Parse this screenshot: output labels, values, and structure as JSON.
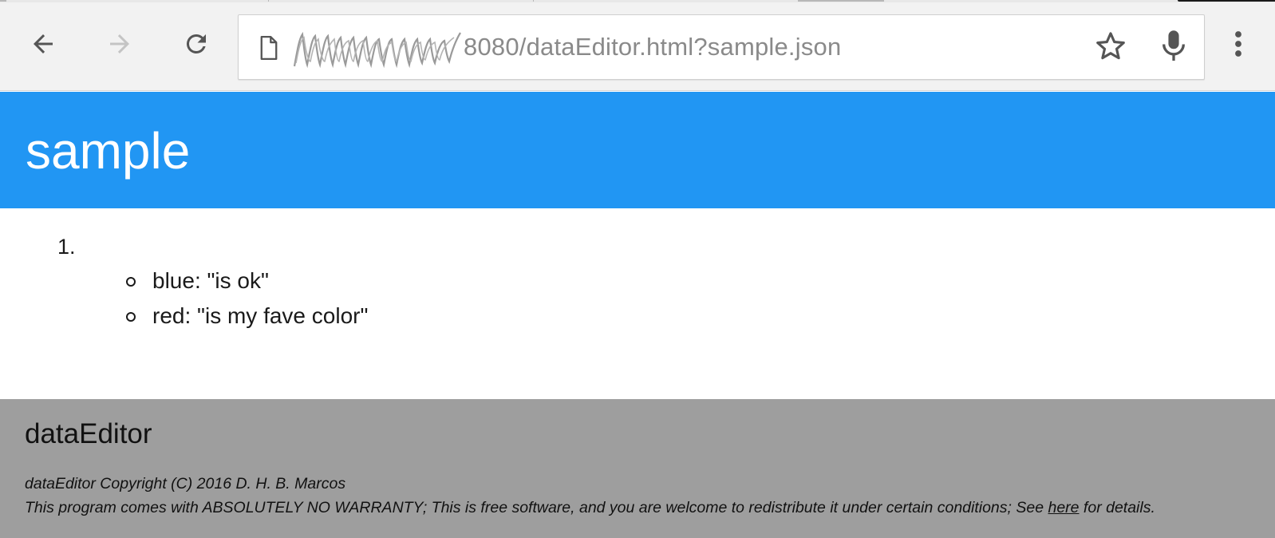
{
  "browser": {
    "url_redacted_host": true,
    "url_visible": "8080/dataEditor.html?sample.json",
    "icons": {
      "back": "arrow-left-icon",
      "forward": "arrow-right-icon",
      "reload": "reload-icon",
      "page": "page-icon",
      "bookmark": "star-icon",
      "voice": "mic-icon",
      "menu": "more-vert-icon"
    }
  },
  "header": {
    "title": "sample",
    "color": "#2196f3"
  },
  "list": {
    "item_number": "1.",
    "entries": [
      {
        "text": "blue: \"is ok\""
      },
      {
        "text": "red: \"is my fave color\""
      }
    ]
  },
  "footer": {
    "app_name": "dataEditor",
    "copyright": "dataEditor Copyright (C) 2016 D. H. B. Marcos",
    "warranty_before": "This program comes with ABSOLUTELY NO WARRANTY; This is free software, and you are welcome to redistribute it under certain conditions; See ",
    "warranty_link": "here",
    "warranty_after": " for details.",
    "color": "#9e9e9e"
  }
}
